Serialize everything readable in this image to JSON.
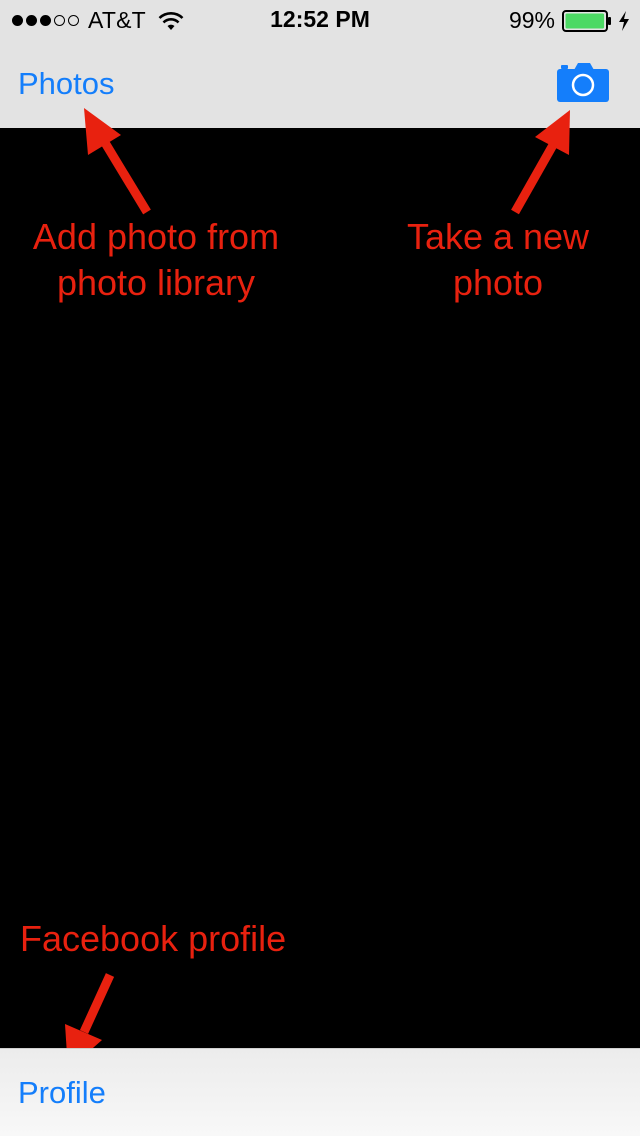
{
  "status_bar": {
    "signal_dots_filled": 3,
    "signal_dots_total": 5,
    "carrier": "AT&T",
    "time": "12:52 PM",
    "battery_percent": "99%",
    "battery_level": 0.99,
    "charging": true
  },
  "nav_bar": {
    "left_button_label": "Photos",
    "right_button_icon": "camera-icon"
  },
  "toolbar": {
    "left_button_label": "Profile"
  },
  "annotations": {
    "photos_line1": "Add photo from",
    "photos_line2": "photo library",
    "camera_line1": "Take a new",
    "camera_line2": "photo",
    "profile": "Facebook profile"
  },
  "colors": {
    "accent": "#147efb",
    "annotation": "#e8210f",
    "bar_background": "#e3e3e3",
    "content_background": "#000000",
    "battery_fill": "#4cd964"
  }
}
